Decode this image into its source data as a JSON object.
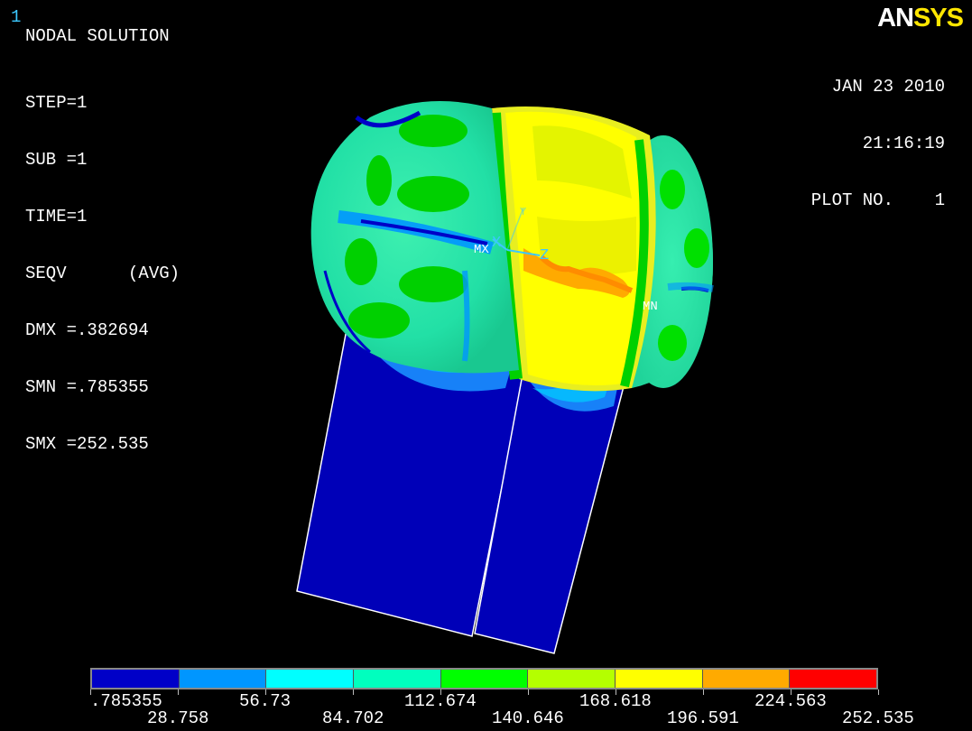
{
  "window_number": "1",
  "title": "NODAL SOLUTION",
  "params": [
    "STEP=1",
    "SUB =1",
    "TIME=1",
    "SEQV      (AVG)",
    "DMX =.382694",
    "SMN =.785355",
    "SMX =252.535"
  ],
  "header_right": {
    "date": "JAN 23 2010",
    "time": "21:16:19",
    "plot_no": "PLOT NO.    1"
  },
  "logo": {
    "an": "AN",
    "sys": "SYS"
  },
  "model_labels": {
    "mx": "MX",
    "mn": "MN",
    "x_axis": "X",
    "z_axis": "Z",
    "y_axis": "Y"
  },
  "legend": {
    "colors": [
      "#0000c8",
      "#0096ff",
      "#00ffff",
      "#00ffbe",
      "#00ff00",
      "#b4ff00",
      "#ffff00",
      "#ffaa00",
      "#ff0000"
    ],
    "labels_top": [
      ".785355",
      "56.73",
      "112.674",
      "168.618",
      "224.563"
    ],
    "labels_bottom": [
      "28.758",
      "84.702",
      "140.646",
      "196.591",
      "252.535"
    ]
  }
}
